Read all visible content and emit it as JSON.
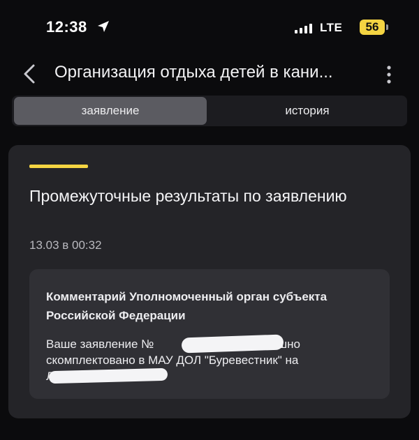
{
  "status_bar": {
    "time": "12:38",
    "network": "LTE",
    "battery": "56"
  },
  "header": {
    "title": "Организация отдыха детей в кани..."
  },
  "tabs": [
    {
      "label": "заявление",
      "active": true
    },
    {
      "label": "история",
      "active": false
    }
  ],
  "card": {
    "title": "Промежуточные результаты по заявлению",
    "date": "13.03 в 00:32",
    "comment": {
      "heading": "Комментарий Уполномоченный орган субъекта Российской Федерации",
      "body_line1_prefix": "Ваше заявление №",
      "body_line1_suffix": "1 успешно",
      "body_line2": "скомплектовано в МАУ ДОЛ \"Буревестник\" на",
      "body_line3_prefix": "Л"
    }
  },
  "colors": {
    "accent": "#f4d442",
    "background": "#0b0b0d",
    "card": "#242428",
    "comment_box": "#303035",
    "active_tab": "#5b5b61"
  },
  "icons": {
    "back": "chevron-left-icon",
    "more": "more-vertical-icon",
    "location": "location-arrow-icon",
    "signal": "signal-bars-icon"
  }
}
